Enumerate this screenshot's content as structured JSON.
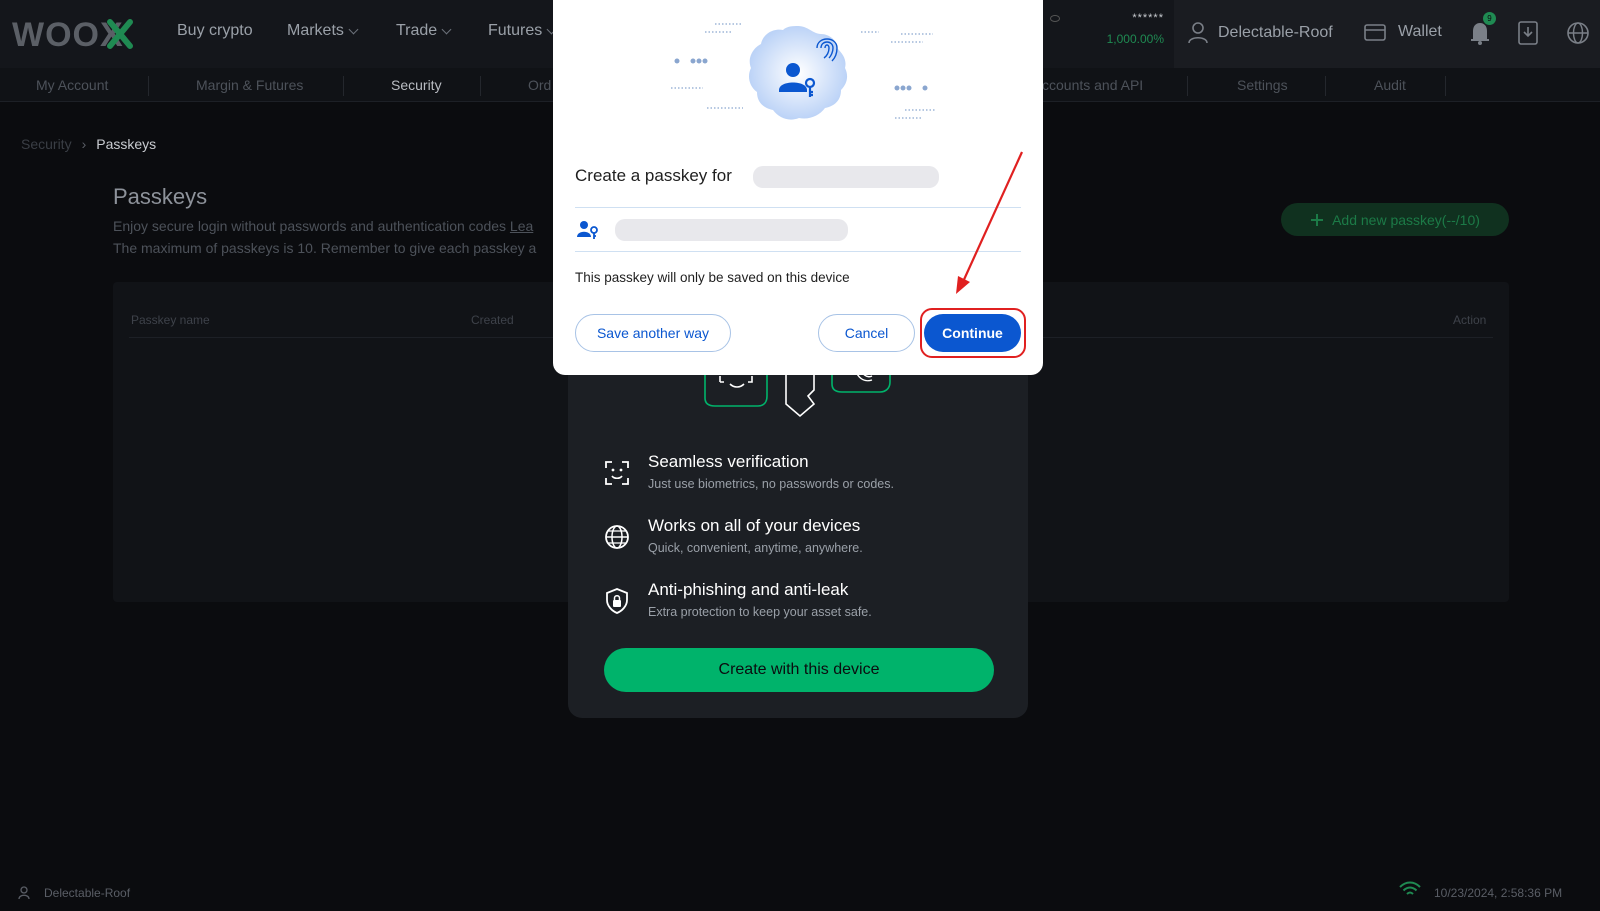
{
  "brand": {
    "logo_text": "WOOX"
  },
  "topnav": {
    "items": [
      {
        "label": "Buy crypto"
      },
      {
        "label": "Markets"
      },
      {
        "label": "Trade"
      },
      {
        "label": "Futures"
      }
    ],
    "balance_masked": "******",
    "balance_pct": "1,000.00%",
    "username": "Delectable-Roof",
    "wallet_label": "Wallet",
    "notif_count": "9"
  },
  "subnav": {
    "items": [
      {
        "label": "My Account"
      },
      {
        "label": "Margin & Futures"
      },
      {
        "label": "Security"
      },
      {
        "label": "Ord"
      },
      {
        "label": "ccounts and API"
      },
      {
        "label": "Settings"
      },
      {
        "label": "Audit"
      }
    ]
  },
  "breadcrumb": {
    "prev": "Security",
    "sep": "›",
    "current": "Passkeys"
  },
  "page": {
    "title": "Passkeys",
    "desc_line1": "Enjoy secure login without passwords and authentication codes",
    "desc_link": "Lea",
    "desc_line2": "The maximum of passkeys is 10. Remember to give each passkey a",
    "add_button": "Add new passkey(--/10)"
  },
  "table": {
    "headers": [
      "Passkey name",
      "Created",
      "Action"
    ]
  },
  "passkey_card": {
    "features": [
      {
        "title": "Seamless verification",
        "subtitle": "Just use biometrics, no passwords or codes.",
        "icon": "face-scan-icon"
      },
      {
        "title": "Works on all of your devices",
        "subtitle": "Quick, convenient, anytime, anywhere.",
        "icon": "globe-icon"
      },
      {
        "title": "Anti-phishing and anti-leak",
        "subtitle": "Extra protection to keep your asset safe.",
        "icon": "shield-lock-icon"
      }
    ],
    "create_button": "Create with this device"
  },
  "modal": {
    "title": "Create a passkey for",
    "note": "This passkey will only be saved on this device",
    "save_another_way": "Save another way",
    "cancel": "Cancel",
    "continue": "Continue"
  },
  "footer": {
    "username": "Delectable-Roof",
    "datetime": "10/23/2024, 2:58:36 PM"
  },
  "colors": {
    "accent_green": "#00b36b",
    "modal_blue": "#0b57d0",
    "annotation_red": "#e02020"
  }
}
